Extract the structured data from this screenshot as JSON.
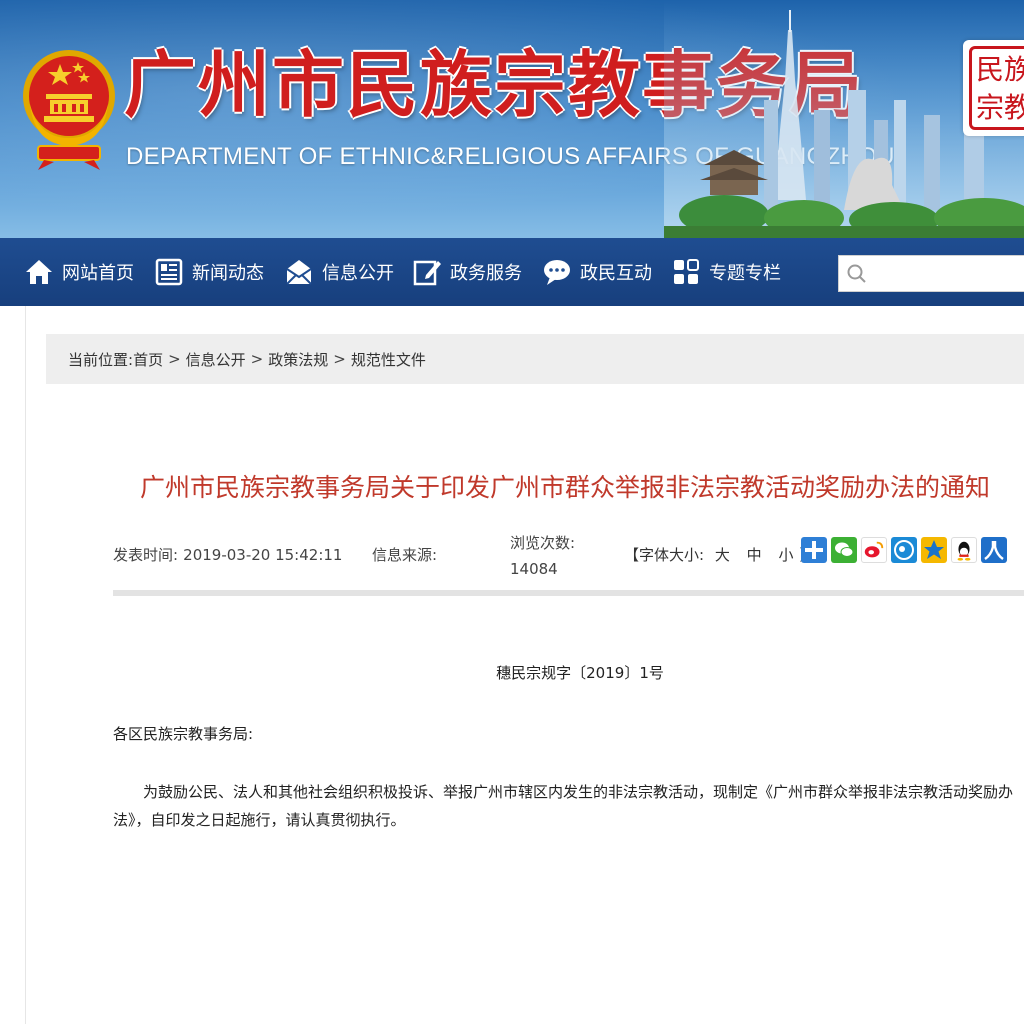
{
  "header": {
    "title": "广州市民族宗教事务局",
    "subtitle": "DEPARTMENT OF ETHNIC&RELIGIOUS AFFAIRS OF GUANGZHOU",
    "seal_text_line1": "民族",
    "seal_text_line2": "宗教"
  },
  "nav": {
    "items": [
      {
        "label": "网站首页",
        "icon": "home-icon"
      },
      {
        "label": "新闻动态",
        "icon": "news-icon"
      },
      {
        "label": "信息公开",
        "icon": "mail-icon"
      },
      {
        "label": "政务服务",
        "icon": "edit-icon"
      },
      {
        "label": "政民互动",
        "icon": "chat-icon"
      },
      {
        "label": "专题专栏",
        "icon": "grid-icon"
      }
    ],
    "search_placeholder": ""
  },
  "breadcrumb": {
    "prefix": "当前位置:",
    "items": [
      "首页",
      "信息公开",
      "政策法规",
      "规范性文件"
    ],
    "separator": ">"
  },
  "article": {
    "title": "广州市民族宗教事务局关于印发广州市群众举报非法宗教活动奖励办法的通知",
    "publish_label": "发表时间:",
    "publish_time": "2019-03-20 15:42:11",
    "source_label": "信息来源:",
    "source_value": "",
    "views_label": "浏览次数:",
    "views_value": "14084",
    "font_size_label": "【字体大小:",
    "font_large": "大",
    "font_medium": "中",
    "font_small": "小",
    "font_size_end": "】",
    "share_icons": [
      "plus-share-icon",
      "wechat-share-icon",
      "weibo-share-icon",
      "tencent-weibo-share-icon",
      "qzone-share-icon",
      "qq-share-icon",
      "renren-share-icon"
    ],
    "doc_number": "穗民宗规字〔2019〕1号",
    "salutation": "各区民族宗教事务局:",
    "body": "为鼓励公民、法人和其他社会组织积极投诉、举报广州市辖区内发生的非法宗教活动，现制定《广州市群众举报非法宗教活动奖励办法》，自印发之日起施行，请认真贯彻执行。"
  },
  "colors": {
    "title_red": "#d01e1e",
    "nav_blue": "#1f4d91",
    "article_title": "#c0392b"
  }
}
